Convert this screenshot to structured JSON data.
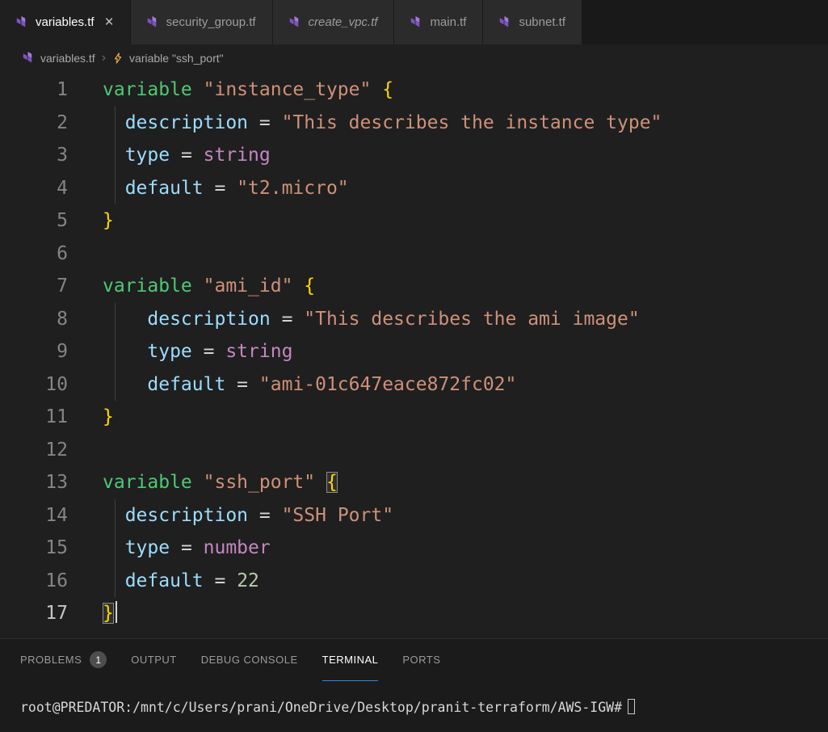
{
  "theme": {
    "editor_bg": "#1f1f1f",
    "strip_bg": "#191919",
    "tab_inactive_bg": "#2b2b2b",
    "tab_active_bg": "#1f1f1f",
    "tab_inactive_fg": "#9d9d9d",
    "tab_active_fg": "#ffffff",
    "breadcrumb_fg": "#a9a9a9",
    "gutter_fg": "#858585",
    "gutter_active_fg": "#c6c6c6",
    "kw": "#4ec975",
    "prop": "#9cdcfe",
    "op": "#d4d4d4",
    "str": "#ce9178",
    "typ": "#c586c0",
    "num": "#b5cea8",
    "brace": "#ffd700",
    "panel_bg": "#1b1b1b",
    "panel_fg": "#9a9a9a",
    "panel_active_fg": "#ffffff",
    "underline": "#2f86d9",
    "badge_bg": "#4d4d4d",
    "terminal_fg": "#d8d8d8",
    "terraform_purple": "#7f52c2",
    "symbol_orange": "#e8ab53"
  },
  "icons": {
    "close": "×",
    "chevron": "›",
    "tab_icon": "terraform-icon",
    "breadcrumb_symbol_icon": "symbol-event-icon"
  },
  "tabs": [
    {
      "label": "variables.tf",
      "active": true,
      "close": true
    },
    {
      "label": "security_group.tf"
    },
    {
      "label": "create_vpc.tf",
      "italic": true
    },
    {
      "label": "main.tf"
    },
    {
      "label": "subnet.tf"
    }
  ],
  "breadcrumb": {
    "file": "variables.tf",
    "symbol": "variable \"ssh_port\""
  },
  "editor": {
    "language": "terraform",
    "lines": [
      {
        "n": "1",
        "tokens": [
          [
            "kw",
            "variable"
          ],
          [
            "pl",
            " "
          ],
          [
            "str",
            "\"instance_type\""
          ],
          [
            "pl",
            " "
          ],
          [
            "br",
            "{"
          ]
        ]
      },
      {
        "n": "2",
        "guide": true,
        "tokens": [
          [
            "pl",
            "  "
          ],
          [
            "prop",
            "description"
          ],
          [
            "op",
            " = "
          ],
          [
            "str",
            "\"This describes the instance type\""
          ]
        ]
      },
      {
        "n": "3",
        "guide": true,
        "tokens": [
          [
            "pl",
            "  "
          ],
          [
            "prop",
            "type"
          ],
          [
            "op",
            " = "
          ],
          [
            "type",
            "string"
          ]
        ]
      },
      {
        "n": "4",
        "guide": true,
        "tokens": [
          [
            "pl",
            "  "
          ],
          [
            "prop",
            "default"
          ],
          [
            "op",
            " = "
          ],
          [
            "str",
            "\"t2.micro\""
          ]
        ]
      },
      {
        "n": "5",
        "tokens": [
          [
            "br",
            "}"
          ]
        ]
      },
      {
        "n": "6",
        "tokens": []
      },
      {
        "n": "7",
        "tokens": [
          [
            "kw",
            "variable"
          ],
          [
            "pl",
            " "
          ],
          [
            "str",
            "\"ami_id\""
          ],
          [
            "pl",
            " "
          ],
          [
            "br",
            "{"
          ]
        ]
      },
      {
        "n": "8",
        "guide": true,
        "tokens": [
          [
            "pl",
            "    "
          ],
          [
            "prop",
            "description"
          ],
          [
            "op",
            " = "
          ],
          [
            "str",
            "\"This describes the ami image\""
          ]
        ]
      },
      {
        "n": "9",
        "guide": true,
        "tokens": [
          [
            "pl",
            "    "
          ],
          [
            "prop",
            "type"
          ],
          [
            "op",
            " = "
          ],
          [
            "type",
            "string"
          ]
        ]
      },
      {
        "n": "10",
        "guide": true,
        "tokens": [
          [
            "pl",
            "    "
          ],
          [
            "prop",
            "default"
          ],
          [
            "op",
            " = "
          ],
          [
            "str",
            "\"ami-01c647eace872fc02\""
          ]
        ]
      },
      {
        "n": "11",
        "tokens": [
          [
            "br",
            "}"
          ]
        ]
      },
      {
        "n": "12",
        "tokens": []
      },
      {
        "n": "13",
        "tokens": [
          [
            "kw",
            "variable"
          ],
          [
            "pl",
            " "
          ],
          [
            "str",
            "\"ssh_port\""
          ],
          [
            "pl",
            " "
          ],
          [
            "brm",
            "{"
          ]
        ]
      },
      {
        "n": "14",
        "guide": true,
        "tokens": [
          [
            "pl",
            "  "
          ],
          [
            "prop",
            "description"
          ],
          [
            "op",
            " = "
          ],
          [
            "str",
            "\"SSH Port\""
          ]
        ]
      },
      {
        "n": "15",
        "guide": true,
        "tokens": [
          [
            "pl",
            "  "
          ],
          [
            "prop",
            "type"
          ],
          [
            "op",
            " = "
          ],
          [
            "type",
            "number"
          ]
        ]
      },
      {
        "n": "16",
        "guide": true,
        "tokens": [
          [
            "pl",
            "  "
          ],
          [
            "prop",
            "default"
          ],
          [
            "op",
            " = "
          ],
          [
            "num",
            "22"
          ]
        ]
      },
      {
        "n": "17",
        "active": true,
        "cursor": true,
        "tokens": [
          [
            "brm",
            "}"
          ]
        ]
      }
    ]
  },
  "panel": {
    "tabs": [
      {
        "label": "PROBLEMS",
        "badge": "1"
      },
      {
        "label": "OUTPUT"
      },
      {
        "label": "DEBUG CONSOLE"
      },
      {
        "label": "TERMINAL",
        "active": true
      },
      {
        "label": "PORTS"
      }
    ]
  },
  "terminal": {
    "prompt": "root@PREDATOR:/mnt/c/Users/prani/OneDrive/Desktop/pranit-terraform/AWS-IGW#"
  }
}
